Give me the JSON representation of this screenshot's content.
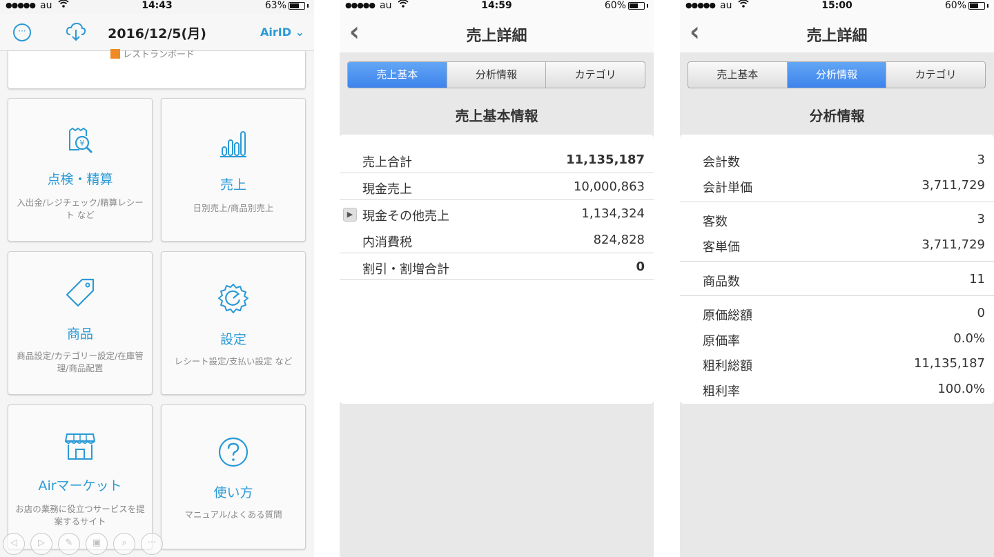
{
  "screen1": {
    "status": {
      "signal": "●●●●●",
      "carrier": "au",
      "time": "14:43",
      "battery": "63%",
      "battery_level": 0.63
    },
    "header": {
      "title": "2016/12/5(月)",
      "airid": "AirID ⌄",
      "chat_icon": "···"
    },
    "banner_label": "レストランボード",
    "tiles": [
      {
        "title": "点検・精算",
        "sub": "入出金/レジチェック/精算レシート など"
      },
      {
        "title": "売上",
        "sub": "日別売上/商品別売上"
      },
      {
        "title": "商品",
        "sub": "商品設定/カテゴリー設定/在庫管理/商品配置"
      },
      {
        "title": "設定",
        "sub": "レシート設定/支払い設定 など"
      },
      {
        "title": "Airマーケット",
        "sub": "お店の業務に役立つサービスを提案するサイト"
      },
      {
        "title": "使い方",
        "sub": "マニュアル/よくある質問"
      }
    ],
    "bottombar": [
      "◁",
      "▷",
      "✎",
      "▣",
      "⌕",
      "···"
    ]
  },
  "screen2": {
    "status": {
      "signal": "●●●●●",
      "carrier": "au",
      "time": "14:59",
      "battery": "60%",
      "battery_level": 0.6
    },
    "nav_title": "売上詳細",
    "back": "‹",
    "tabs": [
      "売上基本",
      "分析情報",
      "カテゴリ"
    ],
    "active_tab": 0,
    "section_title": "売上基本情報",
    "rows": [
      {
        "label": "売上合計",
        "value": "11,135,187"
      },
      {
        "label": "現金売上",
        "value": "10,000,863"
      },
      {
        "label": "現金その他売上",
        "value": "1,134,324"
      },
      {
        "label": "内消費税",
        "value": "824,828"
      },
      {
        "label": "割引・割増合計",
        "value": "0"
      }
    ]
  },
  "screen3": {
    "status": {
      "signal": "●●●●●",
      "carrier": "au",
      "time": "15:00",
      "battery": "60%",
      "battery_level": 0.6
    },
    "nav_title": "売上詳細",
    "back": "‹",
    "tabs": [
      "売上基本",
      "分析情報",
      "カテゴリ"
    ],
    "active_tab": 1,
    "section_title": "分析情報",
    "rows": [
      {
        "label": "会計数",
        "value": "3"
      },
      {
        "label": "会計単価",
        "value": "3,711,729"
      },
      {
        "label": "客数",
        "value": "3"
      },
      {
        "label": "客単価",
        "value": "3,711,729"
      },
      {
        "label": "商品数",
        "value": "11"
      },
      {
        "label": "原価総額",
        "value": "0"
      },
      {
        "label": "原価率",
        "value": "0.0%"
      },
      {
        "label": "粗利総額",
        "value": "11,135,187"
      },
      {
        "label": "粗利率",
        "value": "100.0%"
      }
    ]
  },
  "colors": {
    "accent": "#2a9ad6",
    "tab_active": "#3d83ec",
    "panel_bg": "#e8e8e8"
  }
}
